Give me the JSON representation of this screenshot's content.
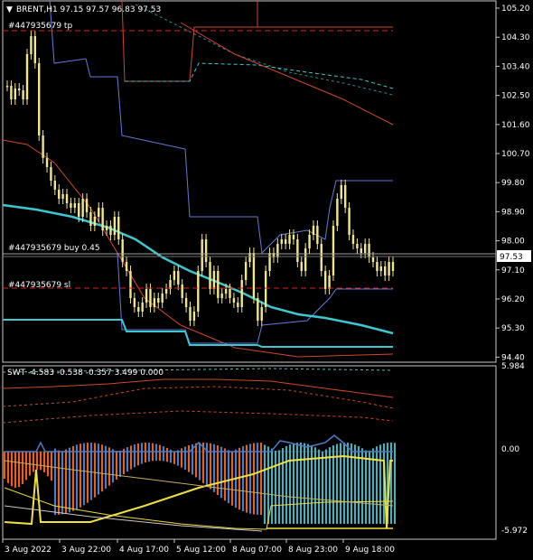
{
  "header": {
    "symbol_line": "BRENT,H1  97.15 97.57 96.83 97.53",
    "price_badge": "97.53"
  },
  "orders": {
    "tp_label": "#447935679 tp",
    "buy_label": "#447935679 buy 0.45",
    "sl_label": "#447935679 sl"
  },
  "main_axis": {
    "ticks": [
      "105.20",
      "104.30",
      "103.40",
      "102.50",
      "101.60",
      "100.70",
      "99.80",
      "98.90",
      "98.00",
      "97.10",
      "96.20",
      "95.30",
      "94.40"
    ]
  },
  "indicator": {
    "header_line": "SWT -4.583 -0.538 -0.357 3.499 0.000",
    "ticks": [
      "5.984",
      "0.00",
      "-5.972"
    ]
  },
  "time_axis": {
    "labels": [
      "3 Aug 2022",
      "3 Aug 22:00",
      "4 Aug 17:00",
      "5 Aug 12:00",
      "8 Aug 07:00",
      "8 Aug 23:00",
      "9 Aug 18:00"
    ]
  },
  "colors": {
    "background": "#000000",
    "candles": "#f0e68c",
    "bollinger": "#6878d8",
    "ma_cyan": "#3cc8d0",
    "ma_red": "#d04828",
    "grid_border": "#c8c8c8",
    "order_line_red": "#e02020",
    "hist_blue": "#4a7cc8",
    "hist_orange": "#e86020",
    "hist_teal": "#5aa8b4"
  }
}
